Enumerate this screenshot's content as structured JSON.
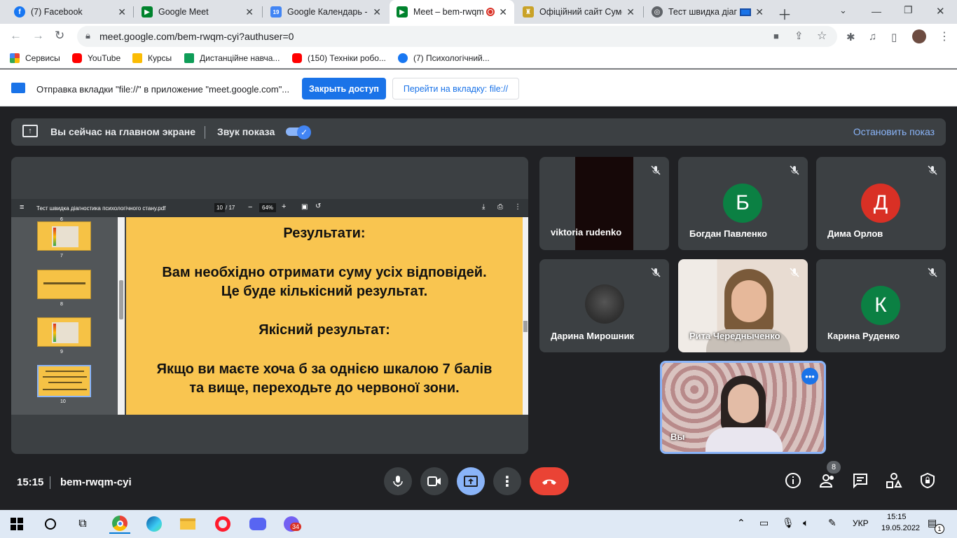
{
  "browser": {
    "tabs": [
      {
        "title": "(7) Facebook",
        "favicon": "facebook-icon",
        "color": "#1877f2",
        "glyph": "f"
      },
      {
        "title": "Google Meet",
        "favicon": "meet-icon",
        "color": "#00832d",
        "glyph": ""
      },
      {
        "title": "Google Календарь - с",
        "favicon": "calendar-icon",
        "color": "#4285f4",
        "glyph": "19"
      },
      {
        "title": "Meet – bem-rwqm",
        "favicon": "meet-icon",
        "color": "#00832d",
        "glyph": ""
      },
      {
        "title": "Офіційний сайт Сумс",
        "favicon": "crest-icon",
        "color": "#c9a227",
        "glyph": ""
      },
      {
        "title": "Тест швидка діагн",
        "favicon": "globe-icon",
        "color": "#5f6368",
        "glyph": ""
      }
    ],
    "url": "meet.google.com/bem-rwqm-cyi?authuser=0",
    "bookmarks": [
      {
        "label": "Сервисы",
        "color": "#ea4335"
      },
      {
        "label": "YouTube",
        "color": "#ff0000"
      },
      {
        "label": "Курсы",
        "color": "#fbbc04"
      },
      {
        "label": "Дистанційне навча...",
        "color": "#0f9d58"
      },
      {
        "label": "(150) Техніки робо...",
        "color": "#ff0000"
      },
      {
        "label": "(7) Психологічний...",
        "color": "#1877f2"
      }
    ]
  },
  "infobar": {
    "message": "Отправка вкладки \"file://\" в приложение \"meet.google.com\"...",
    "close_access": "Закрыть доступ",
    "goto_tab": "Перейти на вкладку: file://"
  },
  "presenting": {
    "status": "Вы сейчас на главном экране",
    "audio_label": "Звук показа",
    "stop_label": "Остановить показ"
  },
  "pdf": {
    "filename": "Тест швидка діагностика психологічного стану.pdf",
    "page": "10",
    "pages": "/ 17",
    "zoom": "64%",
    "thumb_numbers": [
      "6",
      "7",
      "8",
      "9",
      "10"
    ],
    "lines": [
      "Результати:",
      "Вам необхідно отримати суму усіх відповідей.",
      "Це буде кількісний результат.",
      "Якісний результат:",
      "Якщо ви маєте хоча б за однією шкалою 7 балів",
      "та вище, переходьте до червоної зони."
    ]
  },
  "participants": [
    {
      "name": "viktoria rudenko",
      "initial": "",
      "color": ""
    },
    {
      "name": "Богдан Павленко",
      "initial": "Б",
      "color": "#0b8043"
    },
    {
      "name": "Дима Орлов",
      "initial": "Д",
      "color": "#d93025"
    },
    {
      "name": "Дарина Мирошник",
      "initial": "",
      "color": ""
    },
    {
      "name": "Рита Чередныченко",
      "initial": "",
      "color": ""
    },
    {
      "name": "Карина Руденко",
      "initial": "К",
      "color": "#0b8043"
    }
  ],
  "self": {
    "name": "Вы"
  },
  "meeting": {
    "time": "15:15",
    "code": "bem-rwqm-cyi",
    "people_count": "8"
  },
  "taskbar": {
    "lang": "УКР",
    "time": "15:15",
    "date": "19.05.2022",
    "viber_badge": "34",
    "notif": "1"
  }
}
